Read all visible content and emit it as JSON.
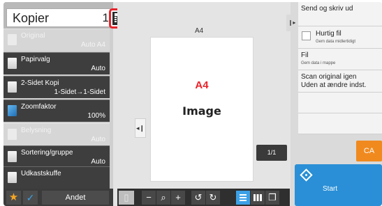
{
  "header": {
    "title": "Kopier",
    "copies": "1"
  },
  "left_menu": [
    {
      "label": "Original",
      "value": "Auto   A4",
      "enabled": false,
      "icon": "original-icon"
    },
    {
      "label": "Papirvalg",
      "value": "Auto",
      "enabled": true,
      "icon": "paper-select-icon"
    },
    {
      "label": "2-Sidet Kopi",
      "value": "1-Sidet→1-Sidet",
      "enabled": true,
      "icon": "duplex-icon"
    },
    {
      "label": "Zoomfaktor",
      "value": "100%",
      "enabled": true,
      "icon": "zoom-icon"
    },
    {
      "label": "Belysning",
      "value": "Auto",
      "enabled": false,
      "icon": "exposure-icon"
    },
    {
      "label": "Sortering/gruppe",
      "value": "Auto",
      "enabled": true,
      "icon": "sort-icon"
    },
    {
      "label": "Udkastskuffe",
      "value": "",
      "enabled": true,
      "icon": "output-tray-icon"
    }
  ],
  "bottom_left": {
    "andet_label": "Andet"
  },
  "preview": {
    "paper_size_label": "A4",
    "paper_text_red": "A4",
    "paper_text_black": "Image",
    "page_counter": "1/1"
  },
  "right_panel": {
    "send_label": "Send og skriv ud",
    "quick_file_title": "Hurtig fil",
    "quick_file_sub": "Gem data midlertidigt",
    "file_title": "Fil",
    "file_sub": "Gem data i mappe",
    "rescan_line1": "Scan original igen",
    "rescan_line2": "Uden at ændre indst.",
    "ca_label": "CA",
    "start_label": "Start"
  },
  "colors": {
    "accent_blue": "#2a8fd6",
    "ca_orange": "#f08a1f",
    "highlight_red": "#e8232a",
    "menu_dark": "#3e3e3e"
  }
}
